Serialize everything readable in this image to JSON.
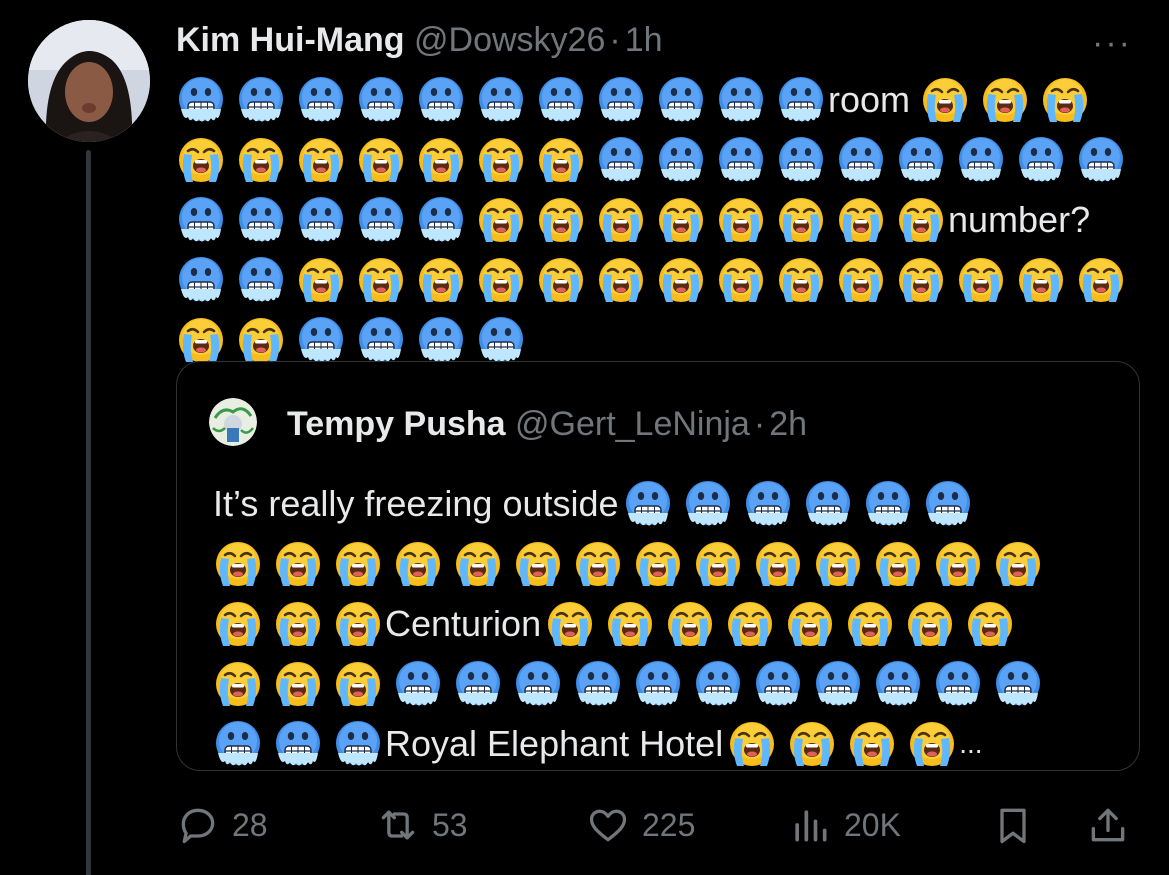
{
  "post": {
    "author_name": "Kim Hui-Mang",
    "author_handle": "@Dowsky26",
    "separator": "·",
    "time": "1h",
    "more_label": "···"
  },
  "post_text": {
    "word_room": "room",
    "word_number": "number?"
  },
  "quote": {
    "author_name": "Tempy Pusha",
    "author_handle": "@Gert_LeNinja",
    "separator": "·",
    "time": "2h",
    "text_intro": "It’s really freezing outside",
    "word_centurion": "Centurion",
    "word_hotel": "Royal Elephant Hotel",
    "ellipsis": "..."
  },
  "actions": {
    "replies": "28",
    "reposts": "53",
    "likes": "225",
    "views": "20K"
  },
  "emoji_names": [
    "cold-face-emoji",
    "loudly-crying-face-emoji"
  ],
  "colors": {
    "background": "#000000",
    "text_primary": "#e7e9ea",
    "text_secondary": "#71767b",
    "border": "#2f3336",
    "cold_face": "#4a90e2",
    "crying_face": "#f5b917"
  }
}
